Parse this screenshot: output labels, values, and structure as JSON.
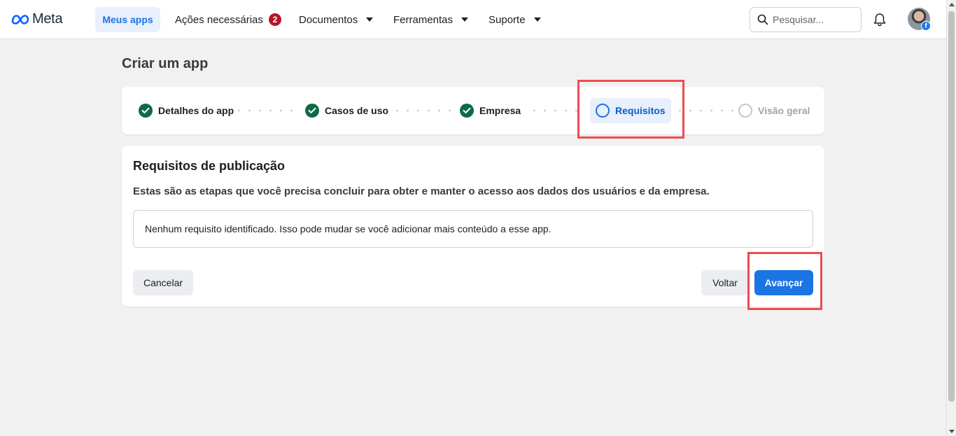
{
  "brand": {
    "name": "Meta",
    "logo_color": "#0866ff"
  },
  "nav": {
    "items": [
      {
        "label": "Meus apps",
        "active": true
      },
      {
        "label": "Ações necessárias",
        "badge": "2"
      },
      {
        "label": "Documentos",
        "dropdown": true
      },
      {
        "label": "Ferramentas",
        "dropdown": true
      },
      {
        "label": "Suporte",
        "dropdown": true
      }
    ],
    "search_placeholder": "Pesquisar...",
    "icons": [
      "search-icon",
      "bell-icon",
      "avatar",
      "facebook-icon"
    ]
  },
  "page": {
    "title": "Criar um app"
  },
  "stepper": {
    "steps": [
      {
        "label": "Detalhes do app",
        "status": "completed"
      },
      {
        "label": "Casos de uso",
        "status": "completed"
      },
      {
        "label": "Empresa",
        "status": "completed"
      },
      {
        "label": "Requisitos",
        "status": "current"
      },
      {
        "label": "Visão geral",
        "status": "upcoming"
      }
    ]
  },
  "card": {
    "title": "Requisitos de publicação",
    "subtitle": "Estas são as etapas que você precisa concluir para obter e manter o acesso aos dados dos usuários e da empresa.",
    "info": "Nenhum requisito identificado. Isso pode mudar se você adicionar mais conteúdo a esse app.",
    "buttons": {
      "cancel": "Cancelar",
      "back": "Voltar",
      "next": "Avançar"
    }
  },
  "colors": {
    "primary": "#1b74e4",
    "success": "#0e6b45",
    "badge": "#b5152b",
    "highlight": "#ee4b52"
  }
}
